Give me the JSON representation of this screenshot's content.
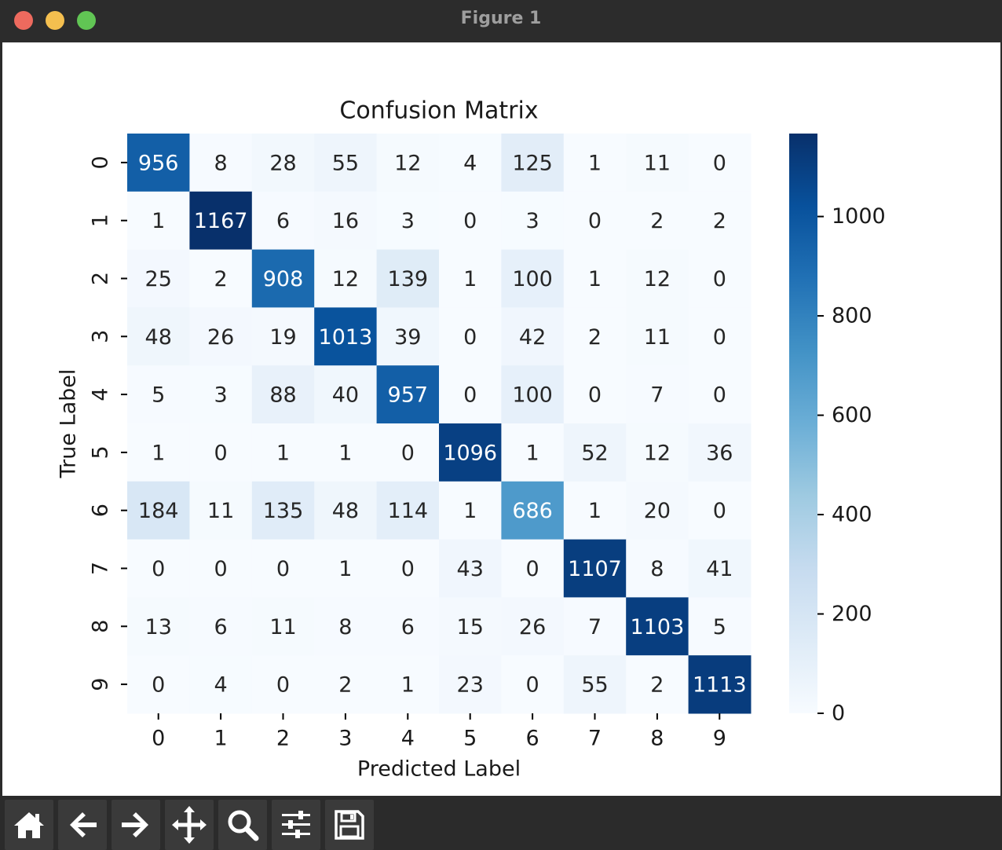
{
  "window": {
    "title": "Figure 1"
  },
  "toolbar": {
    "buttons": [
      {
        "name": "home-button",
        "icon": "home-icon"
      },
      {
        "name": "back-button",
        "icon": "arrow-left-icon"
      },
      {
        "name": "forward-button",
        "icon": "arrow-right-icon"
      },
      {
        "name": "pan-button",
        "icon": "move-icon"
      },
      {
        "name": "zoom-button",
        "icon": "magnifier-icon"
      },
      {
        "name": "configure-subplots-button",
        "icon": "sliders-icon"
      },
      {
        "name": "save-button",
        "icon": "floppy-disk-icon"
      }
    ]
  },
  "chart_data": {
    "type": "heatmap",
    "title": "Confusion Matrix",
    "xlabel": "Predicted Label",
    "ylabel": "True Label",
    "x_categories": [
      "0",
      "1",
      "2",
      "3",
      "4",
      "5",
      "6",
      "7",
      "8",
      "9"
    ],
    "y_categories": [
      "0",
      "1",
      "2",
      "3",
      "4",
      "5",
      "6",
      "7",
      "8",
      "9"
    ],
    "values": [
      [
        956,
        8,
        28,
        55,
        12,
        4,
        125,
        1,
        11,
        0
      ],
      [
        1,
        1167,
        6,
        16,
        3,
        0,
        3,
        0,
        2,
        2
      ],
      [
        25,
        2,
        908,
        12,
        139,
        1,
        100,
        1,
        12,
        0
      ],
      [
        48,
        26,
        19,
        1013,
        39,
        0,
        42,
        2,
        11,
        0
      ],
      [
        5,
        3,
        88,
        40,
        957,
        0,
        100,
        0,
        7,
        0
      ],
      [
        1,
        0,
        1,
        1,
        0,
        1096,
        1,
        52,
        12,
        36
      ],
      [
        184,
        11,
        135,
        48,
        114,
        1,
        686,
        1,
        20,
        0
      ],
      [
        0,
        0,
        0,
        1,
        0,
        43,
        0,
        1107,
        8,
        41
      ],
      [
        13,
        6,
        11,
        8,
        6,
        15,
        26,
        7,
        1103,
        5
      ],
      [
        0,
        4,
        0,
        2,
        1,
        23,
        0,
        55,
        2,
        1113
      ]
    ],
    "colormap": "Blues",
    "colorbar": {
      "min": 0,
      "max": 1167,
      "ticks": [
        0,
        200,
        400,
        600,
        800,
        1000
      ]
    },
    "annotations": true
  }
}
